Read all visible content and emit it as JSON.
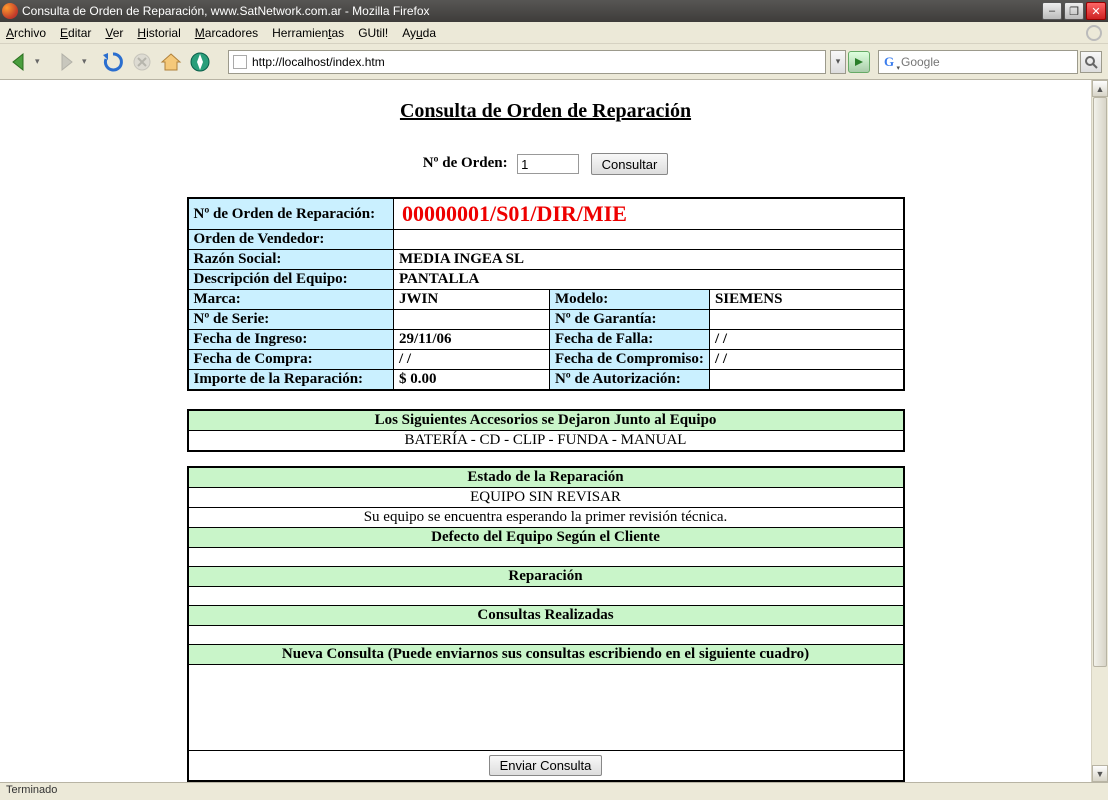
{
  "window": {
    "title": "Consulta de Orden de Reparación, www.SatNetwork.com.ar - Mozilla Firefox"
  },
  "menu": {
    "items": [
      "Archivo",
      "Editar",
      "Ver",
      "Historial",
      "Marcadores",
      "Herramientas",
      "GUtil!",
      "Ayuda"
    ]
  },
  "url": {
    "value": "http://localhost/index.htm"
  },
  "search": {
    "placeholder": "Google"
  },
  "status": {
    "text": "Terminado"
  },
  "page": {
    "title": "Consulta de Orden de Reparación",
    "query": {
      "label": "Nº de Orden:",
      "value": "1",
      "submit": "Consultar"
    },
    "fields": {
      "orden_label": "Nº de Orden de Reparación:",
      "orden_value": "00000001/S01/DIR/MIE",
      "vendedor_label": "Orden de Vendedor:",
      "vendedor_value": "",
      "razon_label": "Razón Social:",
      "razon_value": "MEDIA INGEA SL",
      "desc_label": "Descripción del Equipo:",
      "desc_value": "PANTALLA",
      "marca_label": "Marca:",
      "marca_value": "JWIN",
      "modelo_label": "Modelo:",
      "modelo_value": "SIEMENS",
      "serie_label": "Nº de Serie:",
      "serie_value": "",
      "garantia_label": "Nº de Garantía:",
      "garantia_value": "",
      "ingreso_label": "Fecha de Ingreso:",
      "ingreso_value": "29/11/06",
      "falla_label": "Fecha de Falla:",
      "falla_value": "/ /",
      "compra_label": "Fecha de Compra:",
      "compra_value": "/ /",
      "compromiso_label": "Fecha de Compromiso:",
      "compromiso_value": "/ /",
      "importe_label": "Importe de la Reparación:",
      "importe_value": "$ 0.00",
      "autorizacion_label": "Nº de Autorización:",
      "autorizacion_value": ""
    },
    "accesorios": {
      "header": "Los Siguientes Accesorios se Dejaron Junto al Equipo",
      "value": "BATERÍA - CD - CLIP - FUNDA - MANUAL"
    },
    "estado": {
      "header": "Estado de la Reparación",
      "status": "EQUIPO SIN REVISAR",
      "note": "Su equipo se encuentra esperando la primer revisión técnica.",
      "defecto_header": "Defecto del Equipo Según el Cliente",
      "defecto_value": "",
      "reparacion_header": "Reparación",
      "reparacion_value": "",
      "consultas_header": "Consultas Realizadas",
      "consultas_value": "",
      "nueva_header": "Nueva Consulta (Puede enviarnos sus consultas escribiendo en el siguiente cuadro)",
      "enviar": "Enviar Consulta"
    }
  }
}
